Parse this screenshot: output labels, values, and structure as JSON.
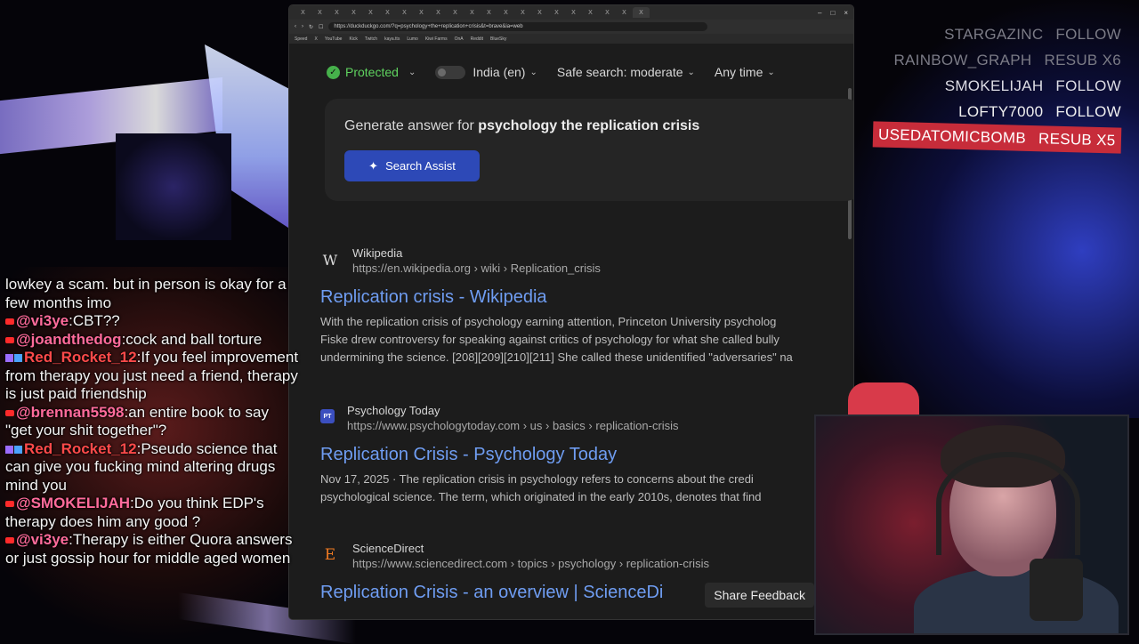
{
  "browser": {
    "url": "https://duckduckgo.com/?q=psychology+the+replication+crisis&t=brave&ia=web",
    "tabs": [
      "X",
      "X",
      "X",
      "X",
      "X",
      "X",
      "X",
      "X",
      "X",
      "X",
      "X",
      "X",
      "X",
      "X",
      "X",
      "X",
      "X",
      "X",
      "X",
      "X",
      "X"
    ],
    "window_controls": [
      "–",
      "□",
      "×"
    ],
    "bookmarks": [
      "Speed",
      "X",
      "YouTube",
      "Kick",
      "Twitch",
      "kaya.tts",
      "Lumo",
      "Kiwi Farms",
      "OnA",
      "Reddit",
      "BlueSky"
    ]
  },
  "filters": {
    "protected": "Protected",
    "region": "India (en)",
    "safe_search": "Safe search: moderate",
    "time": "Any time"
  },
  "assist": {
    "prefix": "Generate answer for ",
    "query": "psychology the replication crisis",
    "button": "Search Assist"
  },
  "results": [
    {
      "site": "Wikipedia",
      "url": "https://en.wikipedia.org › wiki › Replication_crisis",
      "title": "Replication crisis - Wikipedia",
      "favicon": "W",
      "snippet_line1": "With the replication crisis of psychology earning attention, Princeton University psycholog",
      "snippet_line2": "Fiske drew controversy for speaking against critics of psychology for what she called bully",
      "snippet_line3": "undermining the science. [208][209][210][211] She called these unidentified \"adversaries\" na"
    },
    {
      "site": "Psychology Today",
      "url": "https://www.psychologytoday.com › us › basics › replication-crisis",
      "title": "Replication Crisis - Psychology Today",
      "favicon": "PT",
      "date": "Nov 17, 2025",
      "snippet_line1": "The replication crisis in psychology refers to concerns about the credi",
      "snippet_line2": "psychological science. The term, which originated in the early 2010s, denotes that find"
    },
    {
      "site": "ScienceDirect",
      "url": "https://www.sciencedirect.com › topics › psychology › replication-crisis",
      "title": "Replication Crisis - an overview | ScienceDi",
      "favicon": "E"
    }
  ],
  "share_feedback": "Share Feedback",
  "alerts": [
    {
      "user": "STARGAZINC",
      "action": "FOLLOW"
    },
    {
      "user": "RAINBOW_GRAPH",
      "action": "RESUB X6"
    },
    {
      "user": "SMOKELIJAH",
      "action": "FOLLOW"
    },
    {
      "user": "LOFTY7000",
      "action": "FOLLOW"
    },
    {
      "user": "USEDATOMICBOMB",
      "action": "RESUB X5"
    }
  ],
  "chat": [
    {
      "text": "lowkey a scam. but in person is okay for a few months imo"
    },
    {
      "name": "@vi3ye",
      "text": ":CBT??"
    },
    {
      "name": "@joandthedog",
      "text": ":cock and ball torture"
    },
    {
      "name": "Red_Rocket_12",
      "text": ":If you feel improvement from therapy you just need a friend, therapy is just paid friendship"
    },
    {
      "name": "@brennan5598",
      "text": ":an entire book to say \"get your shit together\"?"
    },
    {
      "name": "Red_Rocket_12",
      "text": ":Pseudo science that can give you fucking mind altering drugs mind you"
    },
    {
      "name": "@SMOKELIJAH",
      "text": ":Do you think EDP's therapy does him any good ?"
    },
    {
      "name": "@vi3ye",
      "text": ":Therapy is either Quora answers or just gossip hour for middle aged women"
    }
  ]
}
